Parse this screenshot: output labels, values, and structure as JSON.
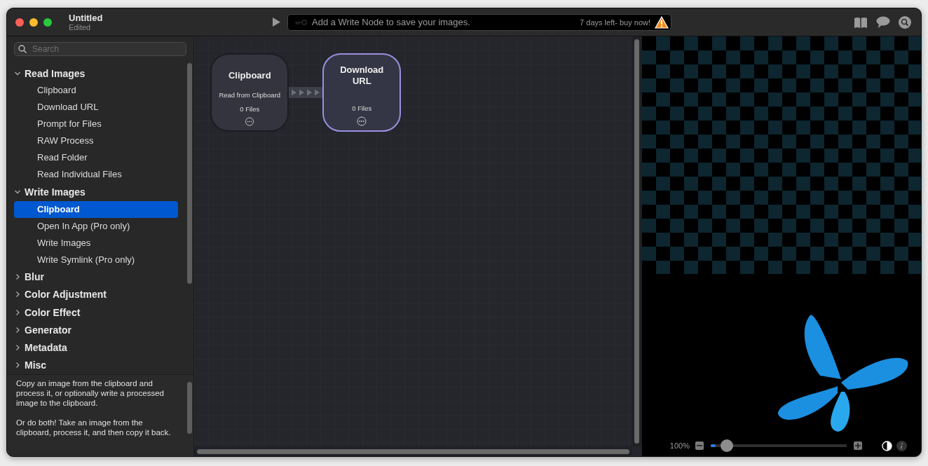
{
  "window": {
    "title": "Untitled",
    "subtitle": "Edited"
  },
  "toolbar": {
    "message": "Add a Write Node to save your images.",
    "trial": "7 days left- buy now!"
  },
  "sidebar": {
    "search": {
      "placeholder": "Search"
    },
    "categories": [
      {
        "label": "Read Images",
        "expanded": true,
        "children": [
          {
            "label": "Clipboard",
            "selected": false
          },
          {
            "label": "Download URL",
            "selected": false
          },
          {
            "label": "Prompt for Files",
            "selected": false
          },
          {
            "label": "RAW Process",
            "selected": false
          },
          {
            "label": "Read Folder",
            "selected": false
          },
          {
            "label": "Read Individual Files",
            "selected": false
          }
        ]
      },
      {
        "label": "Write Images",
        "expanded": true,
        "children": [
          {
            "label": "Clipboard",
            "selected": true
          },
          {
            "label": "Open In App (Pro only)",
            "selected": false
          },
          {
            "label": "Write Images",
            "selected": false
          },
          {
            "label": "Write Symlink (Pro only)",
            "selected": false
          }
        ]
      },
      {
        "label": "Blur",
        "expanded": false
      },
      {
        "label": "Color Adjustment",
        "expanded": false
      },
      {
        "label": "Color Effect",
        "expanded": false
      },
      {
        "label": "Generator",
        "expanded": false
      },
      {
        "label": "Metadata",
        "expanded": false
      },
      {
        "label": "Misc",
        "expanded": false
      }
    ],
    "description": [
      "Copy an image from the clipboard and process it, or optionally write a processed image to the clipboard.",
      "Or do both! Take an image from the clipboard, process it, and then copy it back."
    ]
  },
  "nodes": [
    {
      "title": "Clipboard",
      "subtitle": "Read from Clipboard",
      "count": "0 Files",
      "selected": false
    },
    {
      "title": "Download URL",
      "count": "0 Files",
      "selected": true
    }
  ],
  "preview": {
    "zoom": "100%",
    "level": 0.08
  }
}
